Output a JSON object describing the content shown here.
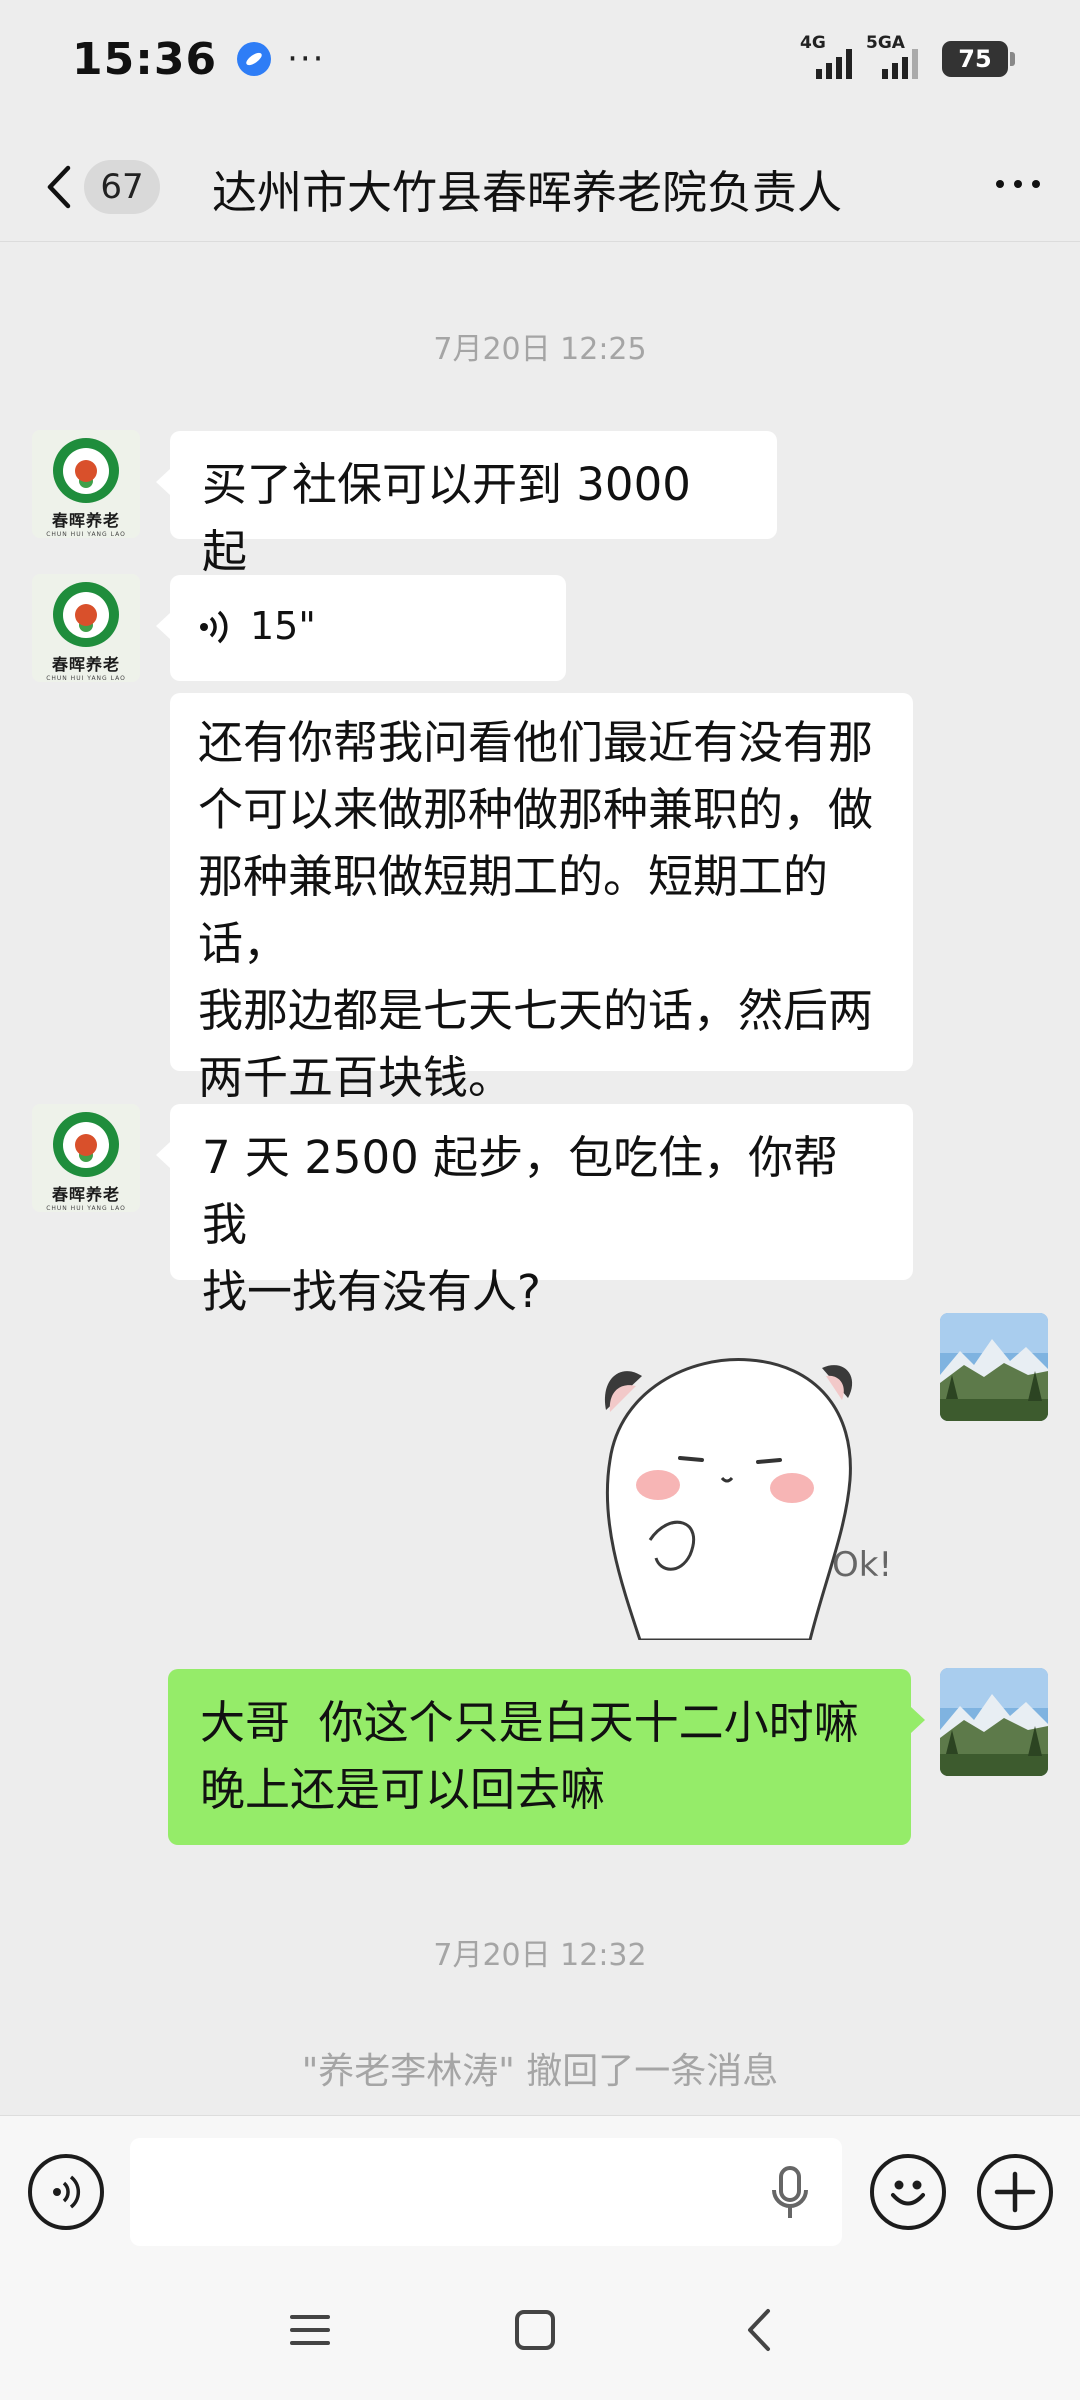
{
  "status_bar": {
    "time": "15:36",
    "dots": "···",
    "network_1": "4G",
    "network_2": "5GA",
    "battery": "75"
  },
  "header": {
    "back_count": "67",
    "title": "达州市大竹县春晖养老院负责人"
  },
  "contact_avatar": {
    "logo_text": "春晖养老",
    "logo_subtext": "CHUN HUI YANG LAO"
  },
  "messages": {
    "timestamp_1": "7月20日 12:25",
    "msg_1": "买了社保可以开到 3000 起",
    "voice_duration": "15\"",
    "msg_2_lines": [
      "还有你帮我问看他们最近有没有那",
      "个可以来做那种做那种兼职的，做",
      "那种兼职做短期工的。短期工的话，",
      "我那边都是七天七天的话，然后两",
      "两千五百块钱。"
    ],
    "msg_3_lines": [
      "7 天 2500 起步，包吃住，你帮我",
      "找一找有没有人?"
    ],
    "sticker_text": "Ok!",
    "msg_4_lines": [
      "大哥  你这个只是白天十二小时嘛",
      "晚上还是可以回去嘛"
    ],
    "timestamp_2": "7月20日 12:32",
    "recall_notice": "\"养老李林涛\" 撤回了一条消息"
  },
  "input": {
    "value": "",
    "placeholder": ""
  },
  "colors": {
    "background": "#ededed",
    "incoming_bubble": "#ffffff",
    "outgoing_bubble": "#95ec69",
    "meta_text": "#a5a5a5"
  },
  "icons": [
    "back-arrow-icon",
    "more-icon",
    "voice-wave-icon",
    "voice-mode-icon",
    "microphone-icon",
    "emoji-icon",
    "plus-icon",
    "menu-icon",
    "home-square-icon",
    "nav-back-icon"
  ]
}
